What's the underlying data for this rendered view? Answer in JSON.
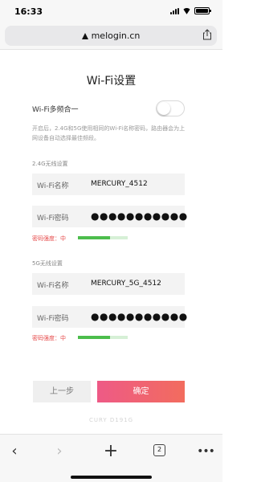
{
  "status_bar": {
    "time": "16:33",
    "icons": [
      "signal-icon",
      "wifi-icon",
      "battery-icon"
    ]
  },
  "browser": {
    "url": "melogin.cn",
    "tab_count": "2",
    "icons": [
      "lock-icon",
      "share-icon",
      "back-arrow-icon",
      "forward-arrow-icon",
      "new-tab-plus-icon",
      "tabs-icon",
      "more-icon"
    ]
  },
  "page": {
    "title": "Wi-Fi设置",
    "multi_band": {
      "label": "Wi-Fi多频合一",
      "enabled": false,
      "note": "开启后，2.4G和5G使用相同的Wi-Fi名称密码，路由器会为上网设备自动选择最佳频段。"
    },
    "band_24": {
      "section_label": "2.4G无线设置",
      "name_label": "Wi-Fi名称",
      "name_value": "MERCURY_4512",
      "password_label": "Wi-Fi密码",
      "password_value": "●●●●●●●●●●●",
      "strength_label": "密码强度：中",
      "strength_level": 0.65
    },
    "band_5": {
      "section_label": "5G无线设置",
      "name_label": "Wi-Fi名称",
      "name_value": "MERCURY_5G_4512",
      "password_label": "Wi-Fi密码",
      "password_value": "●●●●●●●●●●●",
      "strength_label": "密码强度：中",
      "strength_level": 0.65
    },
    "buttons": {
      "back": "上一步",
      "confirm": "确定"
    },
    "footer": "CURY D191G"
  },
  "colors": {
    "accent_gradient_start": "#ee5a86",
    "accent_gradient_end": "#f26c5e",
    "strength_red": "#e64b4b",
    "strength_green": "#4cbd4c"
  }
}
